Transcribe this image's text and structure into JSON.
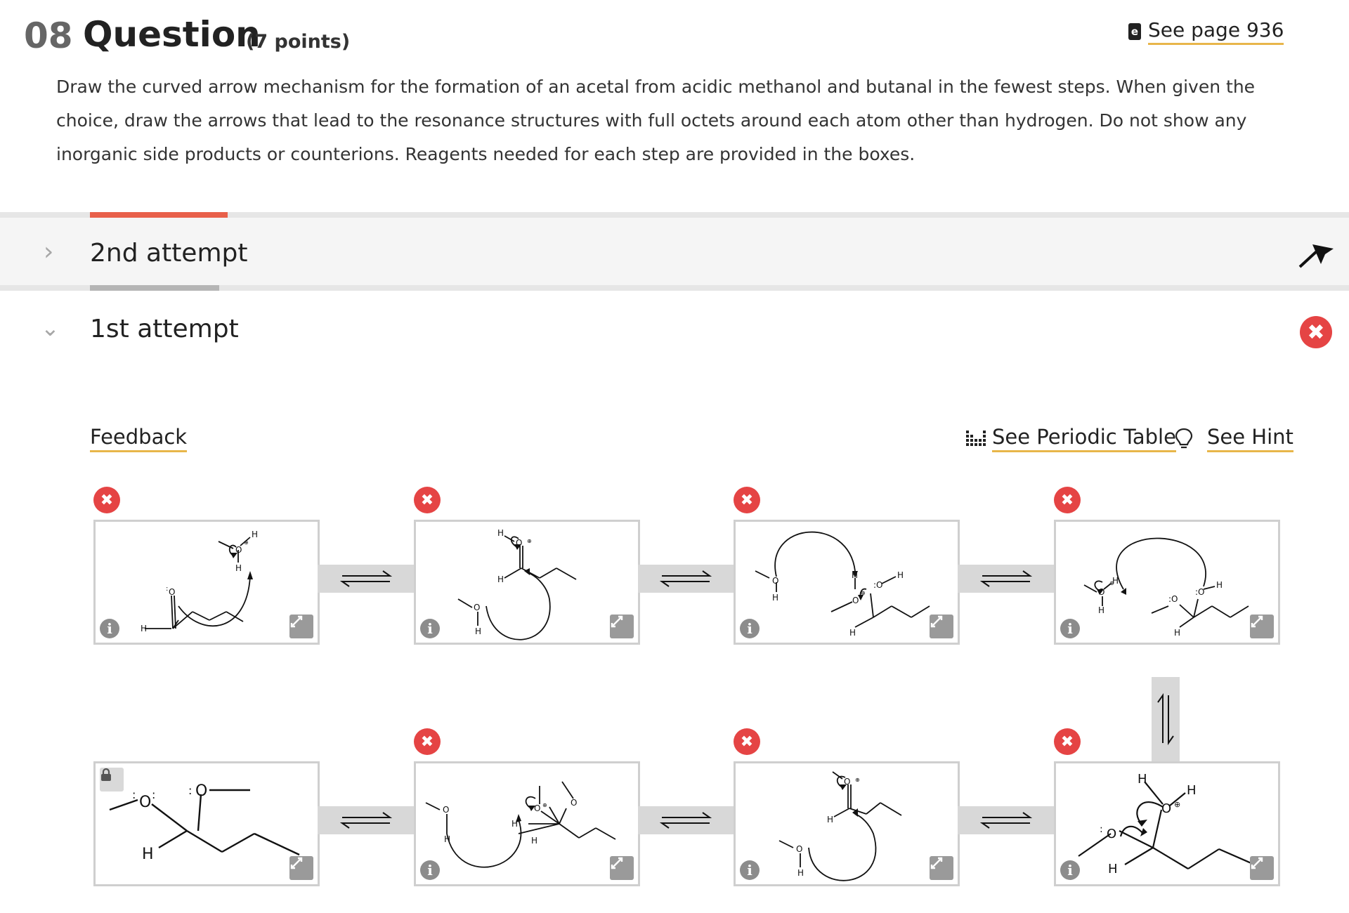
{
  "question": {
    "number": "08",
    "title": "Question",
    "points": "(7 points)",
    "see_page": "See page 936",
    "prompt": "Draw the curved arrow mechanism for the formation of an acetal from acidic methanol and butanal in the fewest steps. When given the choice, draw the arrows that lead to the resonance structures with full octets around each atom other than hydrogen. Do not show any inorganic side products or counterions. Reagents needed for each step are provided in the boxes."
  },
  "attempts": {
    "second": {
      "label": "2nd attempt",
      "chevron": "›"
    },
    "first": {
      "label": "1st attempt",
      "chevron": "⌄",
      "status": "incorrect"
    }
  },
  "toolbar": {
    "feedback": "Feedback",
    "periodic_table": "See Periodic Table",
    "hint": "See Hint"
  },
  "colors": {
    "accent_orange": "#e8604a",
    "link_underline": "#e8b64a",
    "error_red": "#e54444"
  },
  "steps": [
    {
      "id": 1,
      "status": "incorrect",
      "labels": [
        "H",
        "O",
        "H",
        "O",
        "H"
      ]
    },
    {
      "id": 2,
      "status": "incorrect",
      "labels": [
        "H",
        "O",
        "H",
        "O",
        "H"
      ]
    },
    {
      "id": 3,
      "status": "incorrect",
      "labels": [
        "O",
        "H",
        "H",
        "O",
        "O",
        "H",
        "H"
      ]
    },
    {
      "id": 4,
      "status": "incorrect",
      "labels": [
        "O",
        "H",
        "H",
        "O",
        "O",
        "H",
        "H"
      ]
    },
    {
      "id": 5,
      "status": "incorrect",
      "labels": [
        "H",
        "O",
        "H",
        "O",
        "H"
      ]
    },
    {
      "id": 6,
      "status": "incorrect",
      "labels": [
        "O",
        "H",
        "O",
        "H",
        "O",
        "H"
      ]
    },
    {
      "id": 7,
      "status": "incorrect",
      "labels": [
        "O",
        "H",
        "H",
        "O",
        "H"
      ]
    },
    {
      "id": 8,
      "status": "locked",
      "labels": [
        "O",
        "O",
        "H"
      ]
    }
  ],
  "icons": {
    "book": "e-book-icon",
    "periodic": "periodic-table-icon",
    "hint": "lightbulb-icon",
    "info": "i",
    "close": "✖",
    "expand": "expand-icon",
    "lock": "lock-icon"
  }
}
